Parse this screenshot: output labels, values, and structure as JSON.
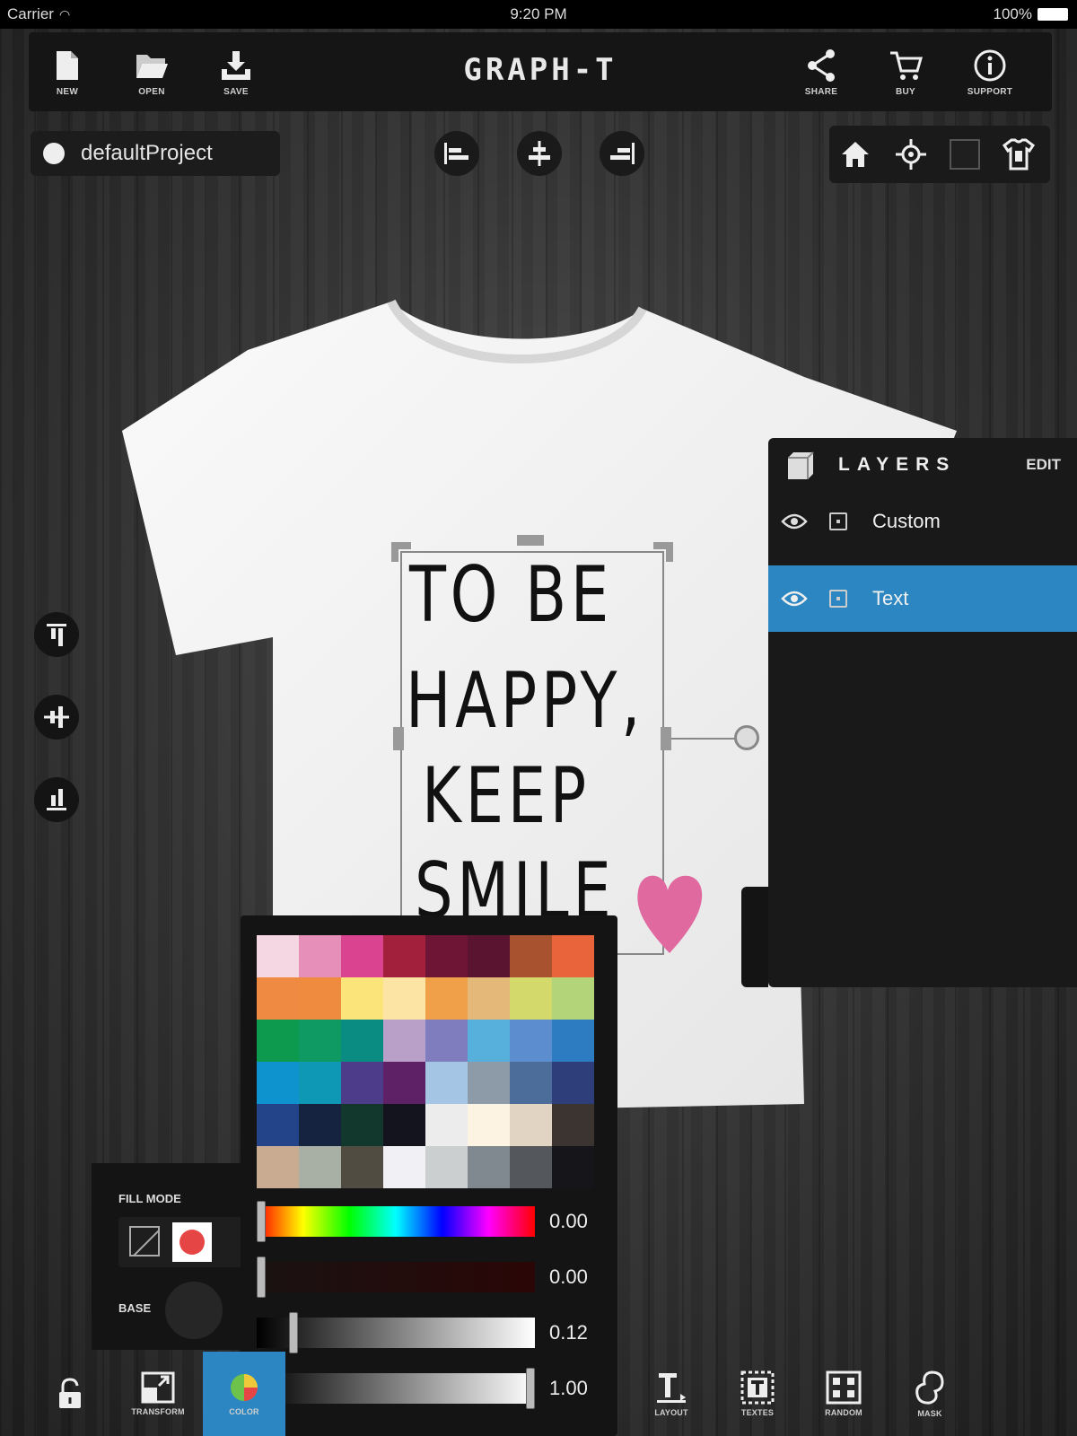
{
  "status_bar": {
    "carrier": "Carrier",
    "time": "9:20 PM",
    "battery": "100%"
  },
  "app_title": "GRAPH-T",
  "toolbar": {
    "left": [
      {
        "label": "NEW",
        "icon": "new-file-icon"
      },
      {
        "label": "OPEN",
        "icon": "open-folder-icon"
      },
      {
        "label": "SAVE",
        "icon": "save-icon"
      }
    ],
    "right": [
      {
        "label": "SHARE",
        "icon": "share-icon"
      },
      {
        "label": "BUY",
        "icon": "cart-icon"
      },
      {
        "label": "SUPPORT",
        "icon": "info-icon"
      }
    ]
  },
  "project": {
    "name": "defaultProject"
  },
  "design": {
    "lines": [
      "TO BE",
      "HAPPY,",
      "KEEP",
      "SMILE"
    ],
    "text_color": "#111111",
    "heart_color": "#e06aa0",
    "shirt_color": "#f2f2f2"
  },
  "layers": {
    "title": "LAYERS",
    "edit_label": "EDIT",
    "items": [
      {
        "name": "Custom",
        "selected": false
      },
      {
        "name": "Text",
        "selected": true
      }
    ]
  },
  "fill_mode": {
    "label": "FILL MODE",
    "base_label": "BASE"
  },
  "color_picker": {
    "swatches": [
      "#f5d7e3",
      "#e68fb8",
      "#d9438f",
      "#a3203c",
      "#6e1535",
      "#5a1430",
      "#a8522f",
      "#e9643a",
      "#ee8a42",
      "#ef8b3f",
      "#fbe57a",
      "#fbe4a4",
      "#f1a04a",
      "#e3b878",
      "#d3d96a",
      "#b4d47a",
      "#0e9a4e",
      "#0f9a64",
      "#0a8c83",
      "#b9a0c9",
      "#7f7dbd",
      "#57b0db",
      "#5c8ecf",
      "#2d7bc1",
      "#0f93cf",
      "#0f98b6",
      "#4d3c8a",
      "#5e2166",
      "#a4c5e4",
      "#8d9aa8",
      "#4c6d99",
      "#2d3e7a",
      "#234489",
      "#152340",
      "#12372c",
      "#14141e",
      "#ececec",
      "#fdf3e3",
      "#e2d4c3",
      "#3b3430",
      "#c9ab92",
      "#a8b0a5",
      "#514c42",
      "#f1f1f5",
      "#cbcfd0",
      "#808890",
      "#54575c",
      "#15151a"
    ],
    "sliders": [
      {
        "name": "hue",
        "value": "0.00",
        "position": 0.0
      },
      {
        "name": "saturation",
        "value": "0.00",
        "position": 0.0
      },
      {
        "name": "brightness",
        "value": "0.12",
        "position": 0.12
      },
      {
        "name": "alpha",
        "value": "1.00",
        "position": 1.0
      }
    ]
  },
  "bottom_toolbar": {
    "items": [
      {
        "label": "",
        "icon": "lock-icon"
      },
      {
        "label": "TRANSFORM",
        "icon": "transform-icon"
      },
      {
        "label": "COLOR",
        "icon": "color-icon",
        "active": true
      },
      {
        "label": "LAYOUT",
        "icon": "layout-icon"
      },
      {
        "label": "TEXTES",
        "icon": "text-icon"
      },
      {
        "label": "RANDOM",
        "icon": "random-icon"
      },
      {
        "label": "MASK",
        "icon": "mask-icon"
      }
    ]
  },
  "colors": {
    "accent": "#2b86c1",
    "panel": "#191919",
    "toolbar": "#151515"
  }
}
